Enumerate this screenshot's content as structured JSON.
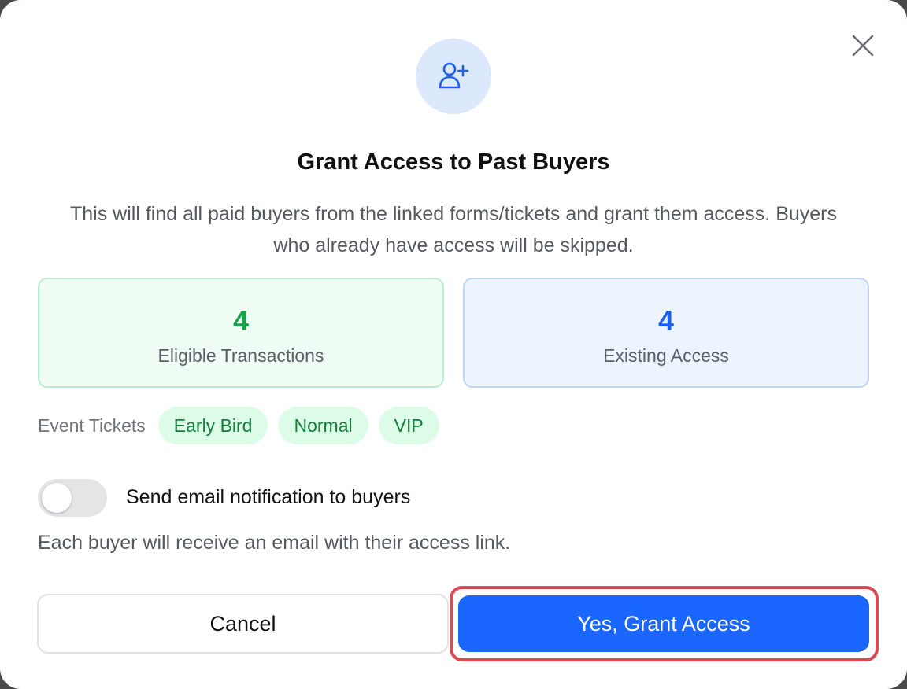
{
  "dialog": {
    "title": "Grant Access to Past Buyers",
    "description": "This will find all paid buyers from the linked forms/tickets and grant them access. Buyers who already have access will be skipped.",
    "header_icon": "user-plus-icon",
    "close_icon": "close-icon"
  },
  "stats": {
    "eligible": {
      "value": "4",
      "label": "Eligible Transactions",
      "color": "#16a34a"
    },
    "existing": {
      "value": "4",
      "label": "Existing Access",
      "color": "#1d5ff0"
    }
  },
  "tickets": {
    "label": "Event Tickets",
    "items": [
      "Early Bird",
      "Normal",
      "VIP"
    ]
  },
  "notification": {
    "label": "Send email notification to buyers",
    "help": "Each buyer will receive an email with their access link.",
    "enabled": false
  },
  "actions": {
    "cancel_label": "Cancel",
    "confirm_label": "Yes, Grant Access",
    "primary_color": "#1a66ff",
    "highlight_color": "#d94b55"
  }
}
